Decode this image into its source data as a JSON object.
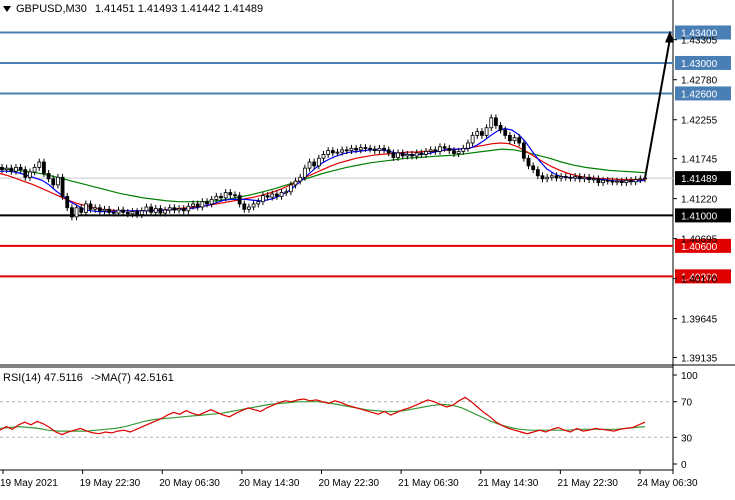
{
  "header": {
    "symbol": "GBPUSD,M30",
    "open": "1.41451",
    "high": "1.41493",
    "low": "1.41442",
    "close": "1.41489"
  },
  "rsi_header": {
    "label": "RSI(14) 47.5116",
    "ma_label": "->MA(7) 42.5161"
  },
  "colors": {
    "blue_level": "#4a7fb5",
    "black_level": "#000000",
    "red_level": "#e00000",
    "ma_fast": "#0000ff",
    "ma_mid": "#e00000",
    "ma_slow": "#008000",
    "rsi": "#e00000",
    "rsi_ma": "#3a9a3a"
  },
  "chart_data": [
    {
      "type": "line",
      "title": "",
      "price_axis_ticks": [
        "1.43305",
        "1.42780",
        "1.42255",
        "1.41745",
        "1.41220",
        "1.40695",
        "1.40170",
        "1.39645",
        "1.39135"
      ],
      "ylim": [
        1.3905,
        1.4359
      ],
      "time_labels": [
        "19 May 2021",
        "19 May 22:30",
        "20 May 06:30",
        "20 May 14:30",
        "20 May 22:30",
        "21 May 06:30",
        "21 May 14:30",
        "21 May 22:30",
        "24 May 06:30"
      ],
      "levels": [
        {
          "value": 1.434,
          "label": "1.43400",
          "color": "#4a7fb5"
        },
        {
          "value": 1.43,
          "label": "1.43000",
          "color": "#4a7fb5"
        },
        {
          "value": 1.426,
          "label": "1.42600",
          "color": "#4a7fb5"
        },
        {
          "value": 1.41,
          "label": "1.41000",
          "color": "#000000"
        },
        {
          "value": 1.406,
          "label": "1.40600",
          "color": "#e00000"
        },
        {
          "value": 1.402,
          "label": "1.40200",
          "color": "#e00000"
        }
      ],
      "current_price": {
        "value": 1.41489,
        "label": "1.41489"
      },
      "close_series": [
        1.416,
        1.4162,
        1.4158,
        1.4163,
        1.416,
        1.415,
        1.4157,
        1.4163,
        1.417,
        1.4155,
        1.4148,
        1.414,
        1.415,
        1.4125,
        1.411,
        1.4098,
        1.411,
        1.4104,
        1.4115,
        1.4108,
        1.411,
        1.4106,
        1.4108,
        1.4104,
        1.4103,
        1.4107,
        1.4104,
        1.4102,
        1.4105,
        1.4101,
        1.4106,
        1.4111,
        1.4104,
        1.4109,
        1.4103,
        1.4107,
        1.411,
        1.4107,
        1.4109,
        1.4106,
        1.4112,
        1.4115,
        1.4111,
        1.4118,
        1.4115,
        1.4121,
        1.4125,
        1.4123,
        1.413,
        1.4127,
        1.4126,
        1.4115,
        1.4108,
        1.4111,
        1.4115,
        1.4118,
        1.4126,
        1.4124,
        1.4128,
        1.4125,
        1.413,
        1.4131,
        1.414,
        1.4145,
        1.415,
        1.4162,
        1.417,
        1.4165,
        1.4175,
        1.418,
        1.4185,
        1.4182,
        1.4183,
        1.4186,
        1.4185,
        1.4188,
        1.4186,
        1.4189,
        1.4188,
        1.4187,
        1.4185,
        1.4188,
        1.4186,
        1.4182,
        1.4176,
        1.4182,
        1.4178,
        1.418,
        1.4178,
        1.4182,
        1.418,
        1.4184,
        1.4186,
        1.4184,
        1.419,
        1.4188,
        1.4185,
        1.4181,
        1.4184,
        1.4188,
        1.4195,
        1.4205,
        1.421,
        1.4205,
        1.4215,
        1.4228,
        1.4218,
        1.4212,
        1.4205,
        1.4198,
        1.4202,
        1.4195,
        1.4175,
        1.4165,
        1.416,
        1.4152,
        1.4148,
        1.415,
        1.4152,
        1.4149,
        1.4151,
        1.415,
        1.4149,
        1.4151,
        1.4148,
        1.415,
        1.4147,
        1.4148,
        1.4143,
        1.4146,
        1.4145,
        1.4144,
        1.4145,
        1.4143,
        1.4146,
        1.4144,
        1.4147,
        1.4148,
        1.4149
      ],
      "ma_fast": [
        1.4158,
        1.4158,
        1.4157,
        1.4155,
        1.4152,
        1.4149,
        1.4146,
        1.414,
        1.4132,
        1.4125,
        1.4118,
        1.4113,
        1.4108,
        1.4106,
        1.4105,
        1.4105,
        1.4105,
        1.4106,
        1.4106,
        1.4106,
        1.4106,
        1.4106,
        1.4106,
        1.4107,
        1.4107,
        1.4108,
        1.4108,
        1.4109,
        1.411,
        1.4112,
        1.4114,
        1.4117,
        1.412,
        1.4121,
        1.4121,
        1.4121,
        1.412,
        1.4119,
        1.412,
        1.4122,
        1.4126,
        1.4131,
        1.4138,
        1.4146,
        1.4154,
        1.4162,
        1.4169,
        1.4174,
        1.4178,
        1.4181,
        1.4183,
        1.4184,
        1.4185,
        1.4186,
        1.4186,
        1.4185,
        1.4183,
        1.4181,
        1.418,
        1.4179,
        1.418,
        1.4181,
        1.4183,
        1.4185,
        1.4187,
        1.4187,
        1.4187,
        1.4188,
        1.4192,
        1.4198,
        1.4205,
        1.4211,
        1.4214,
        1.4212,
        1.4206,
        1.4196,
        1.4183,
        1.4171,
        1.4161,
        1.4155,
        1.4151,
        1.415,
        1.4149,
        1.4149,
        1.4148,
        1.4148,
        1.4147,
        1.4146,
        1.4145,
        1.4145,
        1.4145,
        1.4145,
        1.4146
      ],
      "ma_mid": [
        1.4155,
        1.4152,
        1.4148,
        1.4144,
        1.414,
        1.4135,
        1.413,
        1.4125,
        1.412,
        1.4116,
        1.4113,
        1.411,
        1.4108,
        1.4107,
        1.4106,
        1.4106,
        1.4106,
        1.4106,
        1.4107,
        1.4107,
        1.4108,
        1.4109,
        1.411,
        1.4111,
        1.4112,
        1.4114,
        1.4116,
        1.4118,
        1.412,
        1.4122,
        1.4124,
        1.4127,
        1.413,
        1.4134,
        1.4139,
        1.4144,
        1.415,
        1.4155,
        1.416,
        1.4165,
        1.4169,
        1.4172,
        1.4175,
        1.4177,
        1.4179,
        1.418,
        1.4181,
        1.4182,
        1.4183,
        1.4183,
        1.4184,
        1.4184,
        1.4185,
        1.4186,
        1.4187,
        1.4188,
        1.419,
        1.4192,
        1.4194,
        1.4195,
        1.4194,
        1.419,
        1.4184,
        1.4177,
        1.417,
        1.4164,
        1.4159,
        1.4155,
        1.4152,
        1.415,
        1.4149,
        1.4148,
        1.4148,
        1.4147,
        1.4147,
        1.4147,
        1.4147
      ],
      "ma_slow": [
        1.4162,
        1.416,
        1.4158,
        1.4156,
        1.4153,
        1.4149,
        1.4145,
        1.4141,
        1.4137,
        1.4133,
        1.4129,
        1.4126,
        1.4123,
        1.4121,
        1.4119,
        1.4118,
        1.4118,
        1.4118,
        1.4119,
        1.4121,
        1.4124,
        1.4127,
        1.4131,
        1.4135,
        1.414,
        1.4145,
        1.415,
        1.4155,
        1.4159,
        1.4163,
        1.4166,
        1.4169,
        1.4171,
        1.4173,
        1.4175,
        1.4176,
        1.4177,
        1.4178,
        1.4179,
        1.4181,
        1.4183,
        1.4185,
        1.4187,
        1.4186,
        1.4183,
        1.4179,
        1.4175,
        1.417,
        1.4166,
        1.4163,
        1.4161,
        1.4159,
        1.4158,
        1.4157,
        1.4156
      ],
      "projection": {
        "from": 1.41489,
        "to": 1.434
      }
    },
    {
      "type": "line",
      "title": "",
      "ylim": [
        0,
        100
      ],
      "ticks": [
        "100",
        "70",
        "30",
        "0"
      ],
      "levels": [
        70,
        30
      ],
      "rsi": [
        38,
        42,
        39,
        44,
        47,
        44,
        48,
        45,
        41,
        36,
        33,
        36,
        38,
        40,
        37,
        35,
        34,
        36,
        35,
        37,
        38,
        36,
        39,
        42,
        45,
        48,
        51,
        55,
        58,
        56,
        60,
        57,
        55,
        58,
        61,
        58,
        55,
        53,
        57,
        60,
        63,
        61,
        59,
        63,
        66,
        69,
        71,
        70,
        72,
        73,
        71,
        72,
        70,
        68,
        71,
        69,
        66,
        64,
        62,
        60,
        58,
        56,
        59,
        55,
        58,
        61,
        63,
        66,
        69,
        72,
        70,
        67,
        64,
        66,
        71,
        75,
        70,
        64,
        58,
        53,
        47,
        43,
        40,
        38,
        36,
        34,
        36,
        38,
        36,
        39,
        41,
        38,
        36,
        40,
        37,
        38,
        40,
        39,
        38,
        37,
        39,
        40,
        41,
        44,
        47
      ],
      "rsi_ma": [
        40,
        41,
        42,
        41,
        40,
        38,
        37,
        37,
        37,
        37,
        38,
        39,
        40,
        42,
        45,
        48,
        50,
        51,
        52,
        53,
        54,
        55,
        56,
        57,
        59,
        61,
        63,
        65,
        67,
        68,
        69,
        70,
        70,
        70,
        69,
        67,
        65,
        63,
        61,
        60,
        59,
        59,
        60,
        62,
        64,
        66,
        67,
        66,
        63,
        58,
        53,
        48,
        44,
        41,
        39,
        38,
        38,
        38,
        38,
        38,
        39,
        39,
        39,
        39,
        39,
        40,
        41,
        42
      ]
    }
  ]
}
